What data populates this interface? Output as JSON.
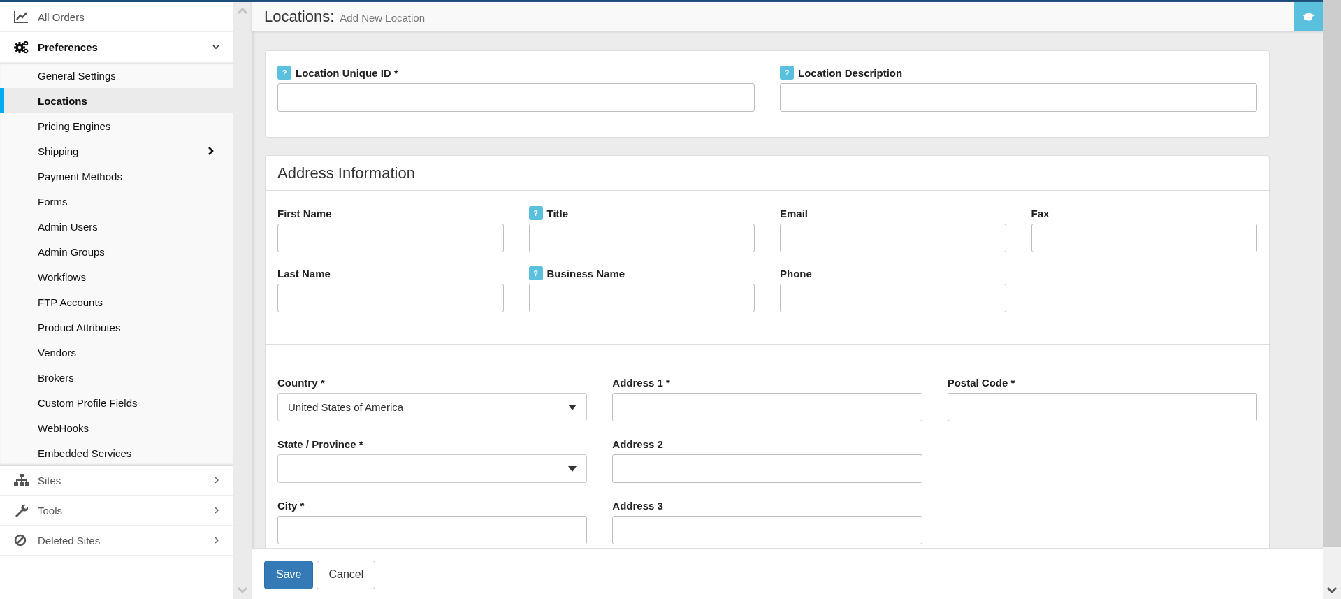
{
  "header": {
    "title": "Locations:",
    "subtitle": "Add New Location"
  },
  "sidebar": {
    "items": [
      {
        "label": "All Orders",
        "kind": "link"
      },
      {
        "label": "Preferences",
        "kind": "group",
        "expanded": true,
        "children": [
          {
            "label": "General Settings",
            "selected": false,
            "has_submenu": false
          },
          {
            "label": "Locations",
            "selected": true,
            "has_submenu": false
          },
          {
            "label": "Pricing Engines",
            "selected": false,
            "has_submenu": false
          },
          {
            "label": "Shipping",
            "selected": false,
            "has_submenu": true
          },
          {
            "label": "Payment Methods",
            "selected": false,
            "has_submenu": false
          },
          {
            "label": "Forms",
            "selected": false,
            "has_submenu": false
          },
          {
            "label": "Admin Users",
            "selected": false,
            "has_submenu": false
          },
          {
            "label": "Admin Groups",
            "selected": false,
            "has_submenu": false
          },
          {
            "label": "Workflows",
            "selected": false,
            "has_submenu": false
          },
          {
            "label": "FTP Accounts",
            "selected": false,
            "has_submenu": false
          },
          {
            "label": "Product Attributes",
            "selected": false,
            "has_submenu": false
          },
          {
            "label": "Vendors",
            "selected": false,
            "has_submenu": false
          },
          {
            "label": "Brokers",
            "selected": false,
            "has_submenu": false
          },
          {
            "label": "Custom Profile Fields",
            "selected": false,
            "has_submenu": false
          },
          {
            "label": "WebHooks",
            "selected": false,
            "has_submenu": false
          },
          {
            "label": "Embedded Services",
            "selected": false,
            "has_submenu": false
          }
        ]
      },
      {
        "label": "Sites",
        "kind": "group",
        "expanded": false
      },
      {
        "label": "Tools",
        "kind": "group",
        "expanded": false
      },
      {
        "label": "Deleted Sites",
        "kind": "group",
        "expanded": false
      }
    ]
  },
  "id_card": {
    "fields": [
      {
        "label": "Location Unique ID *",
        "help": "?",
        "kind": "input"
      },
      {
        "label": "Location Description",
        "help": "?",
        "kind": "input"
      }
    ]
  },
  "address": {
    "title": "Address Information",
    "contact_fields": [
      {
        "label": "First Name",
        "kind": "input"
      },
      {
        "label": "Title",
        "help": "?",
        "kind": "input"
      },
      {
        "label": "Email",
        "kind": "input"
      },
      {
        "label": "Fax",
        "kind": "input"
      },
      {
        "label": "Last Name",
        "kind": "input"
      },
      {
        "label": "Business Name",
        "help": "?",
        "kind": "input"
      },
      {
        "label": "Phone",
        "kind": "input"
      }
    ],
    "location_columns": [
      [
        {
          "label": "Country *",
          "kind": "select",
          "value": "United States of America"
        },
        {
          "label": "State / Province *",
          "kind": "select"
        },
        {
          "label": "City *",
          "kind": "input"
        }
      ],
      [
        {
          "label": "Address 1 *",
          "kind": "input"
        },
        {
          "label": "Address 2",
          "kind": "input"
        },
        {
          "label": "Address 3",
          "kind": "input"
        }
      ],
      [
        {
          "label": "Postal Code *",
          "kind": "input"
        }
      ]
    ]
  },
  "buttons": [
    {
      "label": "Save",
      "kind": "primary"
    },
    {
      "label": "Cancel",
      "kind": "default"
    }
  ]
}
